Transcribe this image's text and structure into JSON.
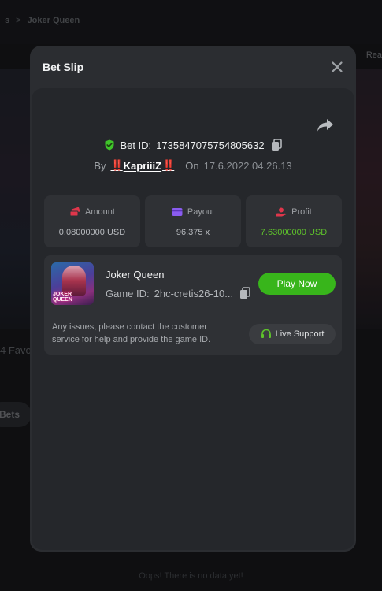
{
  "background": {
    "breadcrumb_prev": "s",
    "breadcrumb_sep": ">",
    "breadcrumb_current": "Joker Queen",
    "real_label": "Rea",
    "favs_label": "4 Favo",
    "bets_tab": "Bets",
    "empty_text": "Oops! There is no data yet!"
  },
  "modal": {
    "title": "Bet Slip",
    "bet_id_label": "Bet ID:",
    "bet_id": "1735847075754805632",
    "by_label": "By",
    "user_excl_left": "‼️",
    "user_name": "KapriiiZ",
    "user_excl_right": "‼️",
    "on_label": "On",
    "date": "17.6.2022 04.26.13",
    "stats": [
      {
        "label": "Amount",
        "value": "0.08000000 USD",
        "icon": "money-stack-icon"
      },
      {
        "label": "Payout",
        "value": "96.375 x",
        "icon": "wallet-icon"
      },
      {
        "label": "Profit",
        "value": "7.63000000 USD",
        "icon": "hand-coin-icon"
      }
    ],
    "game": {
      "name": "Joker Queen",
      "id_label": "Game ID:",
      "id_value": "2hc-cretis26-10...",
      "thumb_text_1": "JOKER",
      "thumb_text_2": "QUEEN",
      "play_button": "Play Now"
    },
    "issue_text": "Any issues, please contact the customer service for help and provide the game ID.",
    "support_button": "Live Support"
  },
  "colors": {
    "accent_green": "#38b51b",
    "profit_green": "#5ec22b",
    "shield_green": "#3fc42a",
    "icon_red": "#e0364b",
    "icon_purple": "#8a5cf0"
  }
}
